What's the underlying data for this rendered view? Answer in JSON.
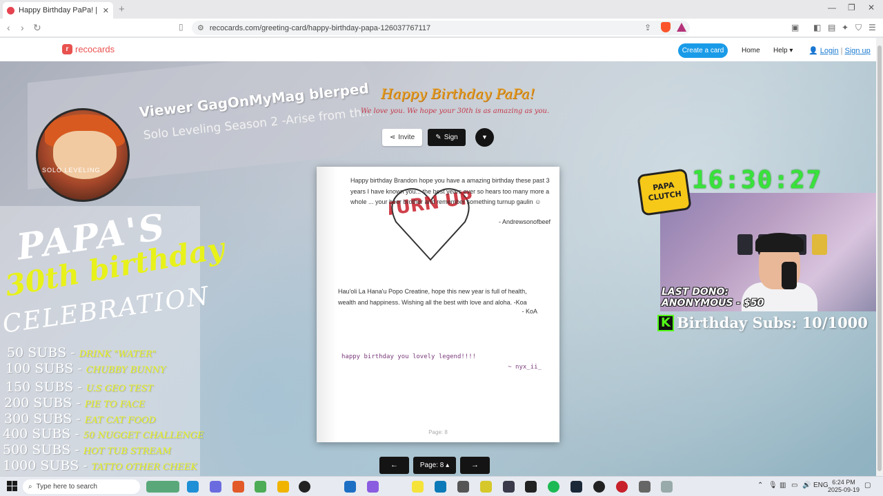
{
  "browser": {
    "tab_title": "Happy Birthday PaPa! | RecoCar…",
    "tab_close": "✕",
    "new_tab": "+",
    "url": "recocards.com/greeting-card/happy-birthday-papa-126037767117"
  },
  "site": {
    "logo": "recocards",
    "create_card": "Create a card",
    "home": "Home",
    "help": "Help",
    "login": "Login",
    "separator": "|",
    "signup": "Sign up"
  },
  "card": {
    "title": "Happy Birthday PaPa!",
    "subtitle": "We love you. We hope your 30th is as amazing as you.",
    "invite": "Invite",
    "sign": "Sign",
    "page_label": "Page: 8",
    "pager_prev": "←",
    "pager_next": "→",
    "pager_current": "Page: 8 ▴",
    "messages": [
      {
        "text": "Happy birthday Brandon hope you have a amazing birthday these past 3 years I have known you... the best years ever so hears too many more a whole ... your beer brother and remember something turnup gaulin ☺",
        "signature": "- Andrewsonofbeef"
      },
      {
        "text": "Hau'oli La Hana'u Popo Creatine, hope this new year is full of health, wealth and happiness. Wishing all the best with love and aloha. -Koa",
        "signature": "- KoA"
      },
      {
        "text": "happy birthday you lovely legend!!!!",
        "signature": "~ nyx_ii_"
      }
    ],
    "sticker_text": "TURN UP"
  },
  "overlay": {
    "alert_title": "Viewer GagOnMyMag blerped",
    "alert_sub": "Solo Leveling Season 2 -Arise from th...",
    "avatar_label": "SOLO LEVELING",
    "goal_h1": "PAPA'S",
    "goal_h2": "30th birthday",
    "goal_h3": "CELEBRATION",
    "goals": [
      {
        "subs": "50 SUBS",
        "reward": "DRINK \"WATER\""
      },
      {
        "subs": "100 SUBS",
        "reward": "CHUBBY BUNNY"
      },
      {
        "subs": "150 SUBS",
        "reward": "U.S GEO TEST"
      },
      {
        "subs": "200 SUBS",
        "reward": "PIE TO FACE"
      },
      {
        "subs": "300 SUBS",
        "reward": "EAT CAT FOOD"
      },
      {
        "subs": "400 SUBS",
        "reward": "50 NUGGET CHALLENGE"
      },
      {
        "subs": "500 SUBS",
        "reward": "HOT TUB STREAM"
      },
      {
        "subs": "1000 SUBS",
        "reward": "TATTO OTHER CHEEK"
      }
    ],
    "clock": "16:30:27",
    "papa_logo": "PAPA CLUTCH",
    "last_dono_1": "LAST DONO:",
    "last_dono_2": "ANONYMOUS - $50",
    "birthday_subs": "Birthday Subs: 10/1000",
    "kick_letter": "K"
  },
  "taskbar": {
    "search": "Type here to search",
    "lang": "ENG",
    "time": "6:24 PM",
    "date": "2025-09-19"
  }
}
